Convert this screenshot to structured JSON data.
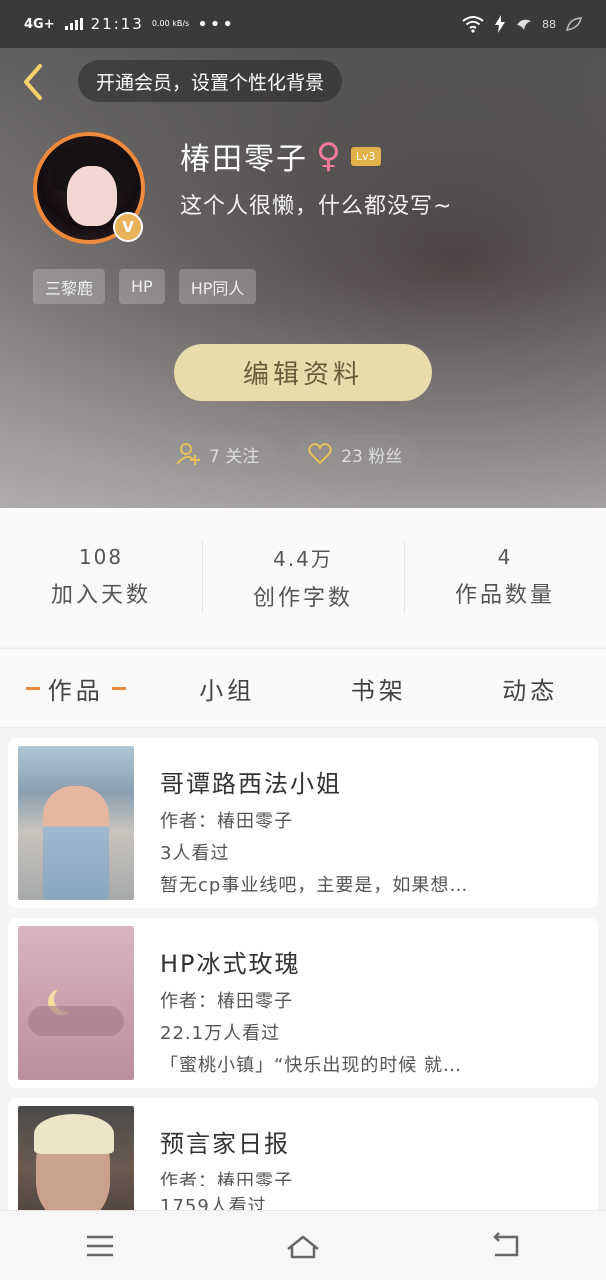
{
  "status_bar": {
    "network": "4G+",
    "time": "21:13",
    "speed": "0.00 kB/s",
    "dots": "•••",
    "battery": "88"
  },
  "header": {
    "vip_banner": "开通会员，设置个性化背景",
    "username": "椿田零子",
    "gender_symbol": "♀",
    "level": "Lv3",
    "verify_badge": "V",
    "bio": "这个人很懒，什么都没写~",
    "tags": [
      "三黎鹿",
      "HP",
      "HP同人"
    ],
    "edit_button": "编辑资料",
    "following": "7 关注",
    "followers": "23 粉丝"
  },
  "stats": [
    {
      "value": "108",
      "label": "加入天数"
    },
    {
      "value": "4.4万",
      "label": "创作字数"
    },
    {
      "value": "4",
      "label": "作品数量"
    }
  ],
  "tabs": [
    "作品",
    "小组",
    "书架",
    "动态"
  ],
  "works": [
    {
      "title": "哥谭路西法小姐",
      "author": "作者：椿田零子",
      "views": "3人看过",
      "desc": "暂无cp事业线吧，主要是，如果想…"
    },
    {
      "title": "HP冰式玫瑰",
      "author": "作者：椿田零子",
      "views": "22.1万人看过",
      "desc": "「蜜桃小镇」“快乐出现的时候 就…"
    },
    {
      "title": "预言家日报",
      "author": "作者：椿田零子",
      "views": "1759人看过",
      "desc": ""
    }
  ],
  "colors": {
    "accent": "#f08a3b",
    "edit_button": "#eadcaa",
    "level_badge": "#e2b14a",
    "gender": "#f47a9a"
  },
  "icons": [
    "back-icon",
    "follow-icon",
    "heart-icon",
    "menu-icon",
    "home-icon",
    "back-nav-icon"
  ]
}
